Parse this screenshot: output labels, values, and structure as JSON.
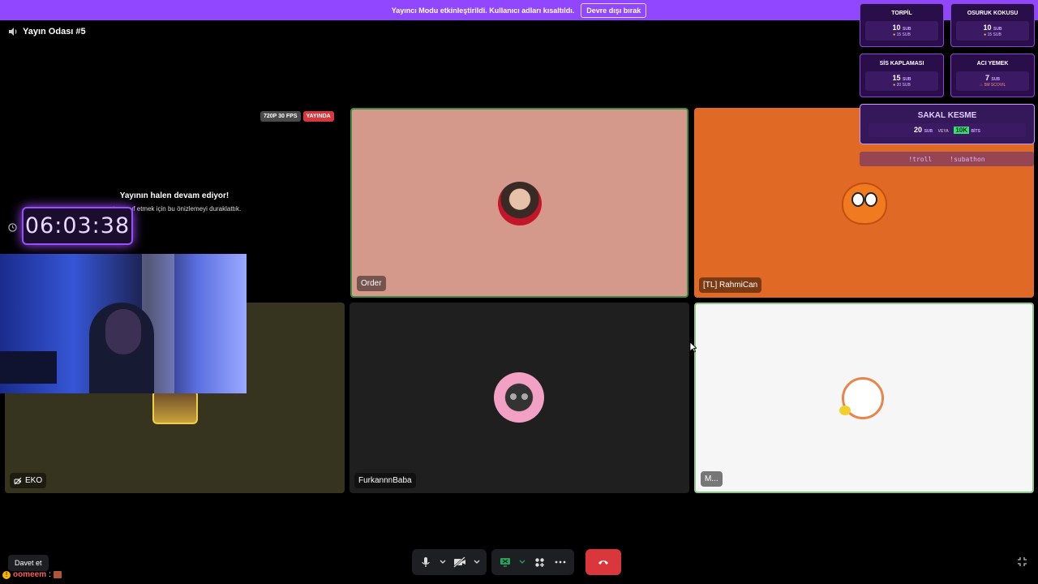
{
  "banner": {
    "text": "Yayıncı Modu etkinleştirildi. Kullanıcı adları kısaltıldı.",
    "button": "Devre dışı bırak"
  },
  "room": {
    "title": "Yayın Odası #5"
  },
  "stream_badges": {
    "quality": "720P 30 FPS",
    "live": "YAYINDA"
  },
  "paused": {
    "title": "Yayının halen devam ediyor!",
    "subtitle": "...tasarruf etmek için bu önizlemeyi duraklattık."
  },
  "timer": {
    "value": "06:03:38"
  },
  "tiles": [
    {
      "name": "Order",
      "bg": "#d4998a"
    },
    {
      "name": "[TL] RahmiCan",
      "bg": "#e06a25"
    },
    {
      "name": "EKO",
      "bg": "#36331e"
    },
    {
      "name": "FurkannnBaba",
      "bg": "#1f1f1f"
    },
    {
      "name": "M...",
      "bg": "#f6f6f6"
    }
  ],
  "rewards": [
    {
      "title": "TORPİL",
      "value": "10",
      "unit": "SUB",
      "sub": "15 SUB"
    },
    {
      "title": "OSURUK KOKUSU",
      "value": "10",
      "unit": "SUB",
      "sub": "15 SUB"
    },
    {
      "title": "SİS KAPLAMASI",
      "value": "15",
      "unit": "SUB",
      "sub": "20 SUB"
    },
    {
      "title": "ACI YEMEK",
      "value": "7",
      "unit": "SUB",
      "sub": "5M SCOVIL"
    },
    {
      "title": "SAKAL KESME",
      "value": "20",
      "unit": "SUB",
      "mid": "VEYA",
      "alt": "10K",
      "alt_unit": "BİTS"
    }
  ],
  "commands": [
    "!troll",
    "!subathon"
  ],
  "toolbar": {
    "invite": "Davet et"
  },
  "chat": {
    "user": "oomeem",
    "sep": ":"
  },
  "colors": {
    "accent": "#9146ff",
    "hangup": "#da373c",
    "active_green": "#23a55a"
  }
}
